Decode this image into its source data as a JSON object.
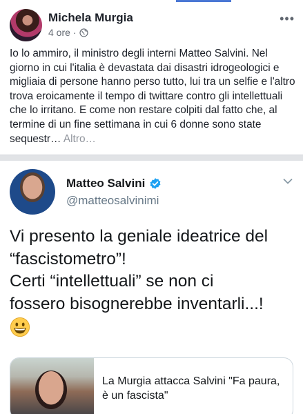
{
  "facebook_post": {
    "author": "Michela Murgia",
    "time": "4 ore",
    "separator": "·",
    "more_label": "•••",
    "body": "Io lo ammiro, il ministro degli interni Matteo Salvini. Nel giorno in cui l'italia è devastata dai disastri idrogeologici e migliaia di persone hanno perso tutto, lui tra un selfie e l'altro trova eroicamente il tempo di twittare contro gli intellettuali che lo irritano. E come non restare colpiti dal fatto che, al termine di un fine settimana in cui 6 donne sono state sequestr…",
    "see_more": "Altro…"
  },
  "tweet": {
    "name": "Matteo Salvini",
    "handle": "@matteosalvinimi",
    "lines": [
      "Vi presento la geniale ideatrice del",
      "“fascistometro”!",
      "Certi “intellettuali” se non ci",
      "fossero bisognerebbe inventarli...!"
    ],
    "emoji": "grinning-face-emoji",
    "card": {
      "title": "La Murgia attacca Salvini \"Fa paura, è un fascista\""
    }
  },
  "colors": {
    "twitter_blue": "#1da1f2",
    "facebook_blue": "#4a77d4",
    "divider": "#e1e3e6",
    "muted_text": "#616770"
  }
}
